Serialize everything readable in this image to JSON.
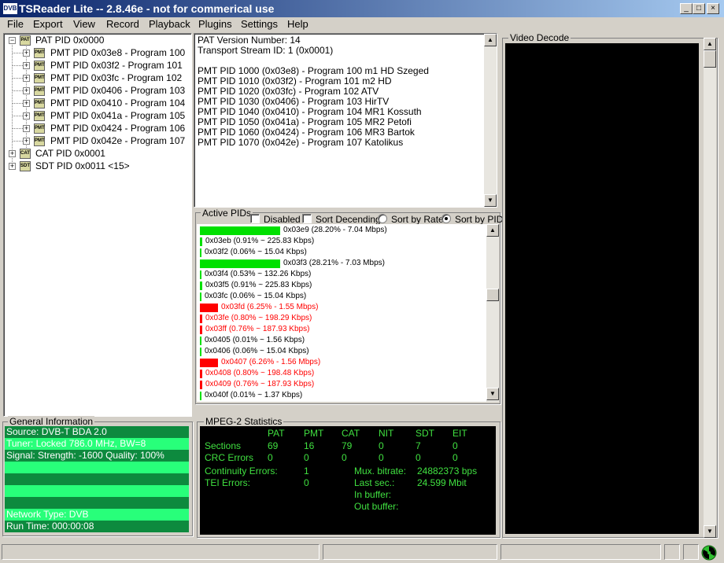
{
  "window": {
    "title": "TSReader Lite -- 2.8.46e - not for commerical use",
    "icon_text": "DVB"
  },
  "window_controls": {
    "minimize": "_",
    "maximize": "□",
    "close": "×"
  },
  "menu": [
    "File",
    "Export",
    "View",
    "Record",
    "Playback",
    "Plugins",
    "Settings",
    "Help"
  ],
  "tree": {
    "pat": "PAT PID 0x0000",
    "programs": [
      "PMT PID 0x03e8 - Program 100",
      "PMT PID 0x03f2 - Program 101",
      "PMT PID 0x03fc - Program 102",
      "PMT PID 0x0406 - Program 103",
      "PMT PID 0x0410 - Program 104",
      "PMT PID 0x041a - Program 105",
      "PMT PID 0x0424 - Program 106",
      "PMT PID 0x042e - Program 107"
    ],
    "cat": "CAT PID 0x0001",
    "sdt": "SDT PID 0x0011 <15>",
    "icon_labels": {
      "pat": "PAT",
      "pmt": "PMT",
      "cat": "CAT",
      "sdt": "SDT"
    }
  },
  "detail": {
    "lines": [
      "PAT Version Number: 14",
      "Transport Stream ID: 1 (0x0001)",
      "",
      "PMT PID 1000 (0x03e8) - Program 100 m1 HD Szeged",
      "PMT PID 1010 (0x03f2) - Program 101 m2 HD",
      "PMT PID 1020 (0x03fc) - Program 102 ATV",
      "PMT PID 1030 (0x0406) - Program 103 HirTV",
      "PMT PID 1040 (0x0410) - Program 104 MR1 Kossuth",
      "PMT PID 1050 (0x041a) - Program 105 MR2 Petofi",
      "PMT PID 1060 (0x0424) - Program 106 MR3 Bartok",
      "PMT PID 1070 (0x042e) - Program 107 Katolikus"
    ]
  },
  "active_pids": {
    "label": "Active PIDs",
    "options": {
      "disabled": "Disabled",
      "sort_desc": "Sort Decending",
      "sort_rate": "Sort by Rate",
      "sort_pid": "Sort by PID"
    },
    "selected_sort": "Sort by PID",
    "colors": {
      "ok": "#00e000",
      "error": "#ff0000",
      "text_ok": "#000000",
      "text_error": "#ff0000"
    },
    "rows": [
      {
        "text": "0x03e9 (28.20% - 7.04 Mbps)",
        "share": 0.282,
        "status": "ok"
      },
      {
        "text": "0x03eb (0.91% ~ 225.83 Kbps)",
        "share": 0.0091,
        "status": "ok"
      },
      {
        "text": "0x03f2 (0.06% ~ 15.04 Kbps)",
        "share": 0.0006,
        "status": "ok"
      },
      {
        "text": "0x03f3 (28.21% - 7.03 Mbps)",
        "share": 0.2821,
        "status": "ok"
      },
      {
        "text": "0x03f4 (0.53% ~ 132.26 Kbps)",
        "share": 0.0053,
        "status": "ok"
      },
      {
        "text": "0x03f5 (0.91% ~ 225.83 Kbps)",
        "share": 0.0091,
        "status": "ok"
      },
      {
        "text": "0x03fc (0.06% ~ 15.04 Kbps)",
        "share": 0.0006,
        "status": "ok"
      },
      {
        "text": "0x03fd (6.25% - 1.55 Mbps)",
        "share": 0.0625,
        "status": "error"
      },
      {
        "text": "0x03fe (0.80% ~ 198.29 Kbps)",
        "share": 0.008,
        "status": "error"
      },
      {
        "text": "0x03ff (0.76% ~ 187.93 Kbps)",
        "share": 0.0076,
        "status": "error"
      },
      {
        "text": "0x0405 (0.01% ~ 1.56 Kbps)",
        "share": 0.0001,
        "status": "ok"
      },
      {
        "text": "0x0406 (0.06% ~ 15.04 Kbps)",
        "share": 0.0006,
        "status": "ok"
      },
      {
        "text": "0x0407 (6.26% - 1.56 Mbps)",
        "share": 0.0626,
        "status": "error"
      },
      {
        "text": "0x0408 (0.80% ~ 198.48 Kbps)",
        "share": 0.008,
        "status": "error"
      },
      {
        "text": "0x0409 (0.76% ~ 187.93 Kbps)",
        "share": 0.0076,
        "status": "error"
      },
      {
        "text": "0x040f (0.01% ~ 1.37 Kbps)",
        "share": 0.0001,
        "status": "ok"
      }
    ]
  },
  "general_info": {
    "label": "General Information",
    "colors": {
      "dark": "#0d8a3e",
      "light": "#28ff7a"
    },
    "rows": [
      "Source: DVB-T BDA 2.0",
      "Tuner: Locked 786.0 MHz, BW=8",
      "Signal: Strength: -1600 Quality: 100%",
      "",
      "",
      "",
      "",
      "Network Type: DVB",
      "Run Time: 000:00:08"
    ]
  },
  "mpeg2": {
    "label": "MPEG-2 Statistics",
    "columns": [
      "PAT",
      "PMT",
      "CAT",
      "NIT",
      "SDT",
      "EIT"
    ],
    "sections": {
      "label": "Sections",
      "values": [
        "69",
        "16",
        "79",
        "0",
        "7",
        "0"
      ]
    },
    "crc": {
      "label": "CRC Errors",
      "values": [
        "0",
        "0",
        "0",
        "0",
        "0",
        "0"
      ]
    },
    "continuity": {
      "label": "Continuity Errors:",
      "value": "1"
    },
    "tei": {
      "label": "TEI Errors:",
      "value": "0"
    },
    "mux_bitrate": {
      "label": "Mux. bitrate:",
      "value": "24882373 bps"
    },
    "last_sec": {
      "label": "Last sec.:",
      "value": "24.599 Mbit"
    },
    "in_buffer": {
      "label": "In buffer:"
    },
    "out_buffer": {
      "label": "Out buffer:"
    }
  },
  "video": {
    "label": "Video Decode"
  }
}
